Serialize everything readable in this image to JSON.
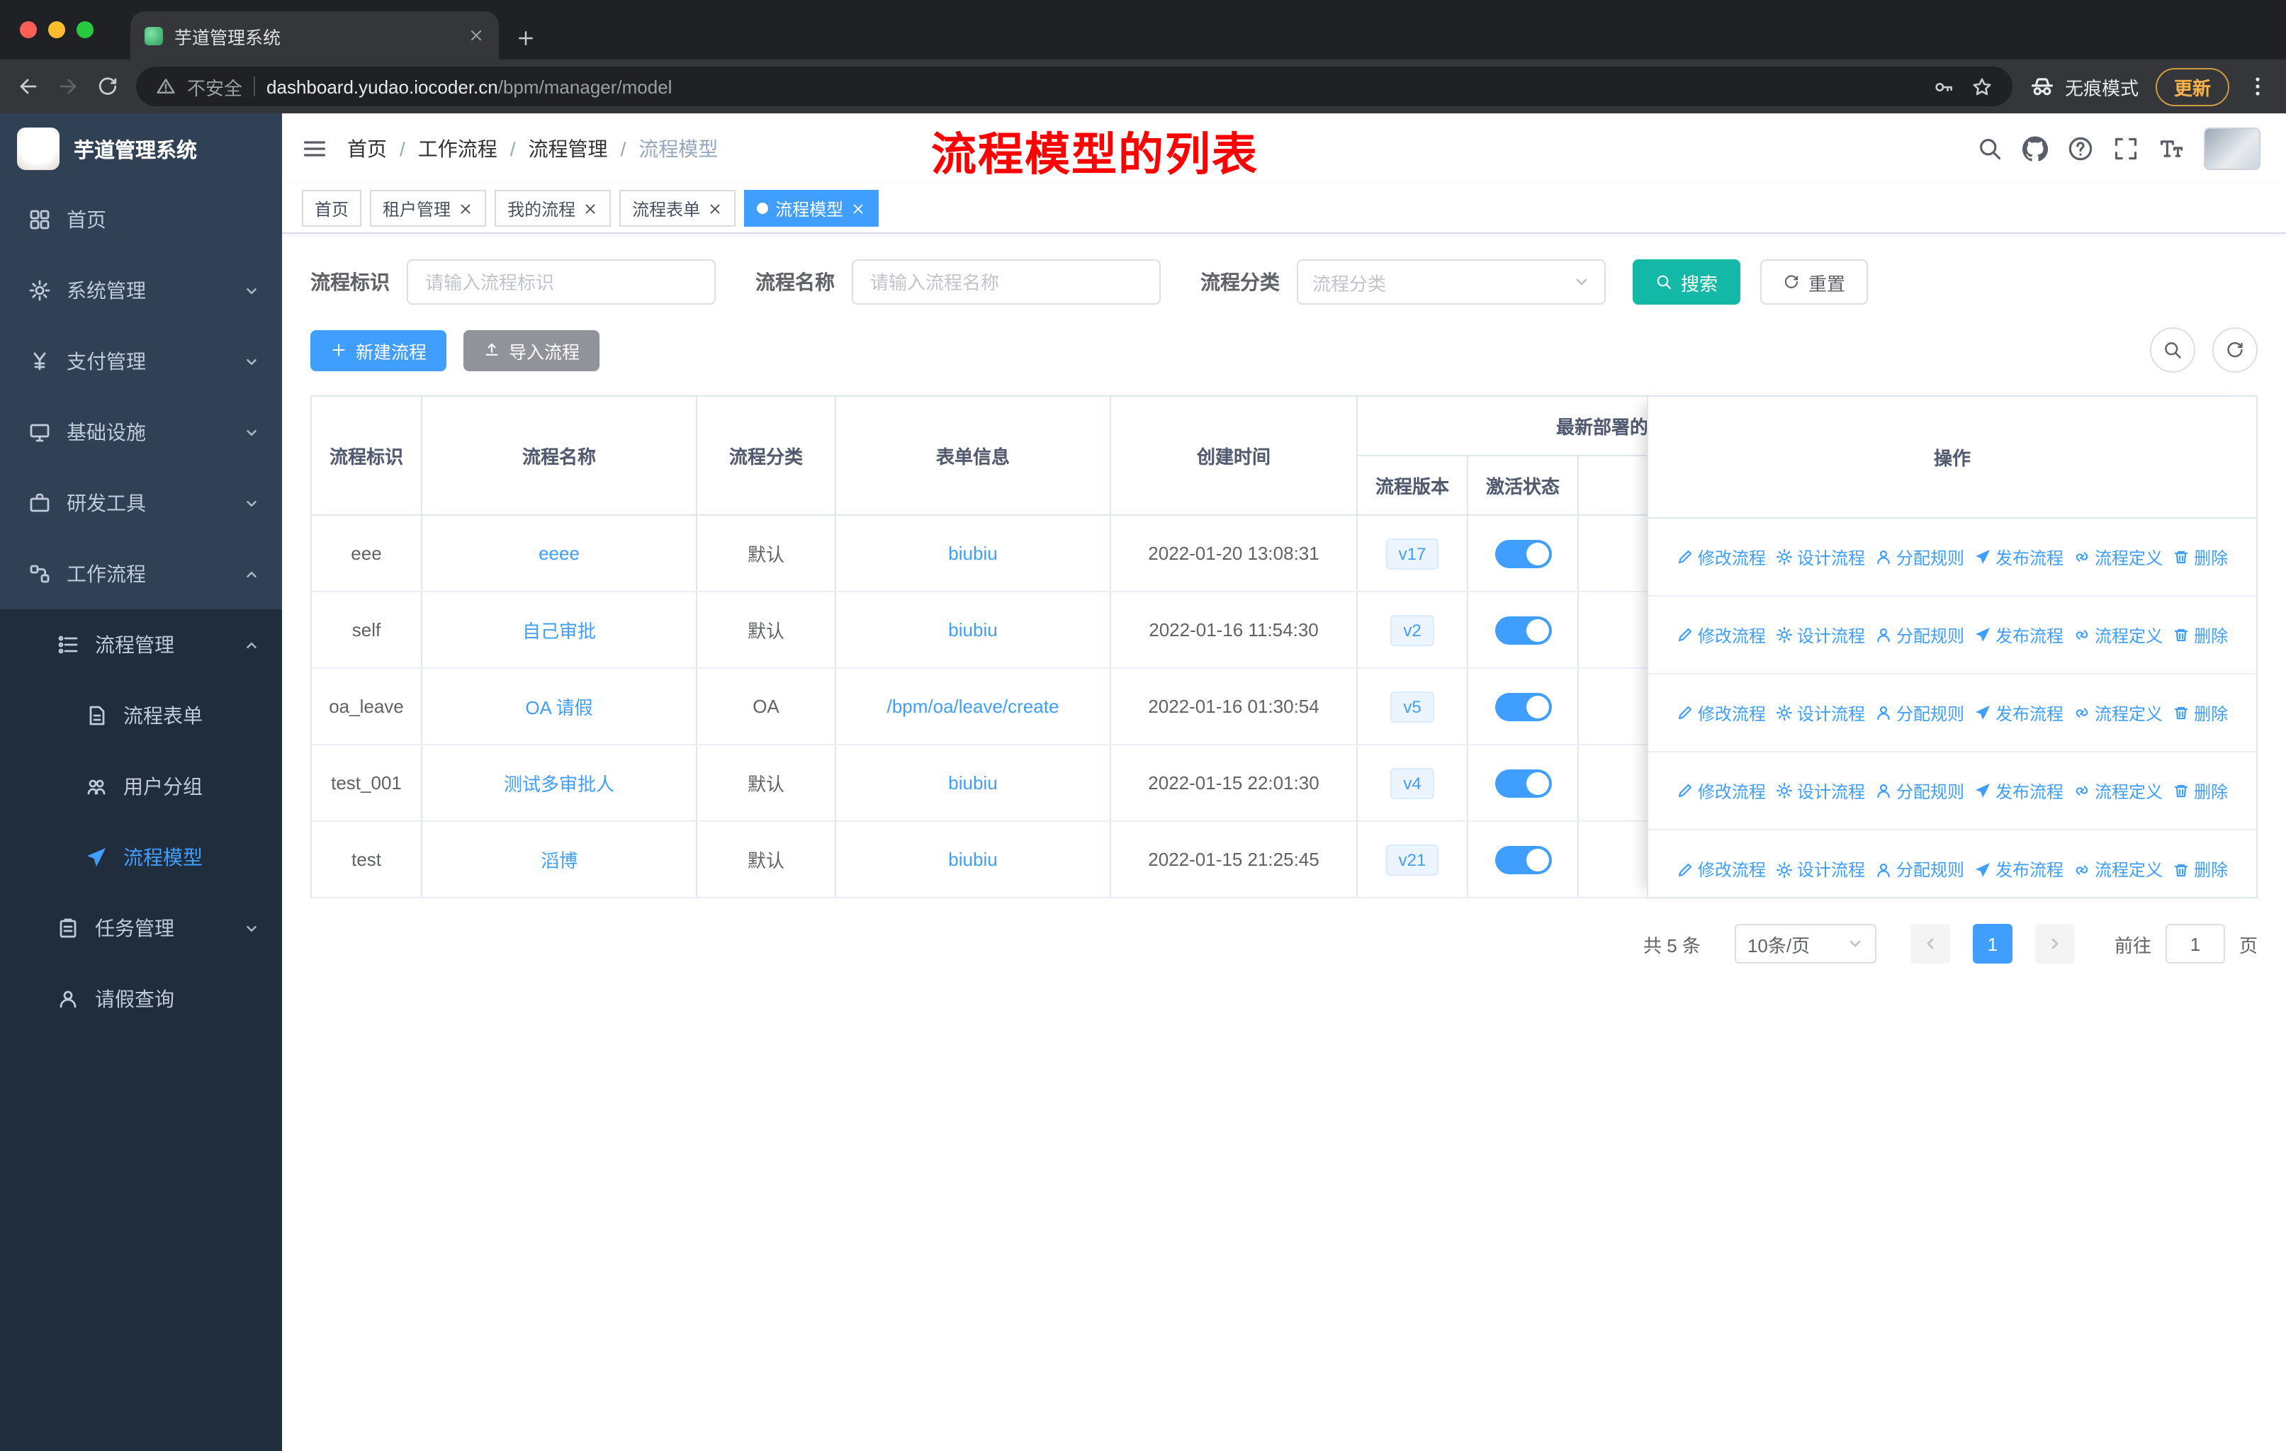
{
  "browser": {
    "tab_title": "芋道管理系统",
    "security_label": "不安全",
    "url_host": "dashboard.yudao.iocoder.cn",
    "url_path": "/bpm/manager/model",
    "incognito_label": "无痕模式",
    "update_label": "更新"
  },
  "sidebar": {
    "logo_title": "芋道管理系统",
    "items": [
      {
        "label": "首页"
      },
      {
        "label": "系统管理"
      },
      {
        "label": "支付管理"
      },
      {
        "label": "基础设施"
      },
      {
        "label": "研发工具"
      },
      {
        "label": "工作流程"
      },
      {
        "label": "流程管理"
      },
      {
        "label": "流程表单"
      },
      {
        "label": "用户分组"
      },
      {
        "label": "流程模型"
      },
      {
        "label": "任务管理"
      },
      {
        "label": "请假查询"
      }
    ]
  },
  "navbar": {
    "breadcrumb": [
      {
        "label": "首页"
      },
      {
        "label": "工作流程"
      },
      {
        "label": "流程管理"
      },
      {
        "label": "流程模型"
      }
    ],
    "breadcrumb_separator": "/",
    "annotation": "流程模型的列表"
  },
  "tags": [
    {
      "label": "首页"
    },
    {
      "label": "租户管理"
    },
    {
      "label": "我的流程"
    },
    {
      "label": "流程表单"
    },
    {
      "label": "流程模型"
    }
  ],
  "filters": {
    "process_id": {
      "label": "流程标识",
      "placeholder": "请输入流程标识"
    },
    "process_name": {
      "label": "流程名称",
      "placeholder": "请输入流程名称"
    },
    "process_category": {
      "label": "流程分类",
      "placeholder": "流程分类"
    },
    "search_label": "搜索",
    "reset_label": "重置"
  },
  "toolbar": {
    "create_label": "新建流程",
    "import_label": "导入流程"
  },
  "table": {
    "headers": {
      "id": "流程标识",
      "name": "流程名称",
      "category": "流程分类",
      "form": "表单信息",
      "created": "创建时间",
      "group": "最新部署的",
      "version": "流程版本",
      "status": "激活状态",
      "ops": "操作"
    },
    "actions": [
      "修改流程",
      "设计流程",
      "分配规则",
      "发布流程",
      "流程定义",
      "删除"
    ],
    "rows": [
      {
        "id": "eee",
        "name": "eeee",
        "category": "默认",
        "form": "biubiu",
        "created": "2022-01-20 13:08:31",
        "version": "v17",
        "active": true
      },
      {
        "id": "self",
        "name": "自己审批",
        "category": "默认",
        "form": "biubiu",
        "created": "2022-01-16 11:54:30",
        "version": "v2",
        "active": true
      },
      {
        "id": "oa_leave",
        "name": "OA 请假",
        "category": "OA",
        "form": "/bpm/oa/leave/create",
        "created": "2022-01-16 01:30:54",
        "version": "v5",
        "active": true
      },
      {
        "id": "test_001",
        "name": "测试多审批人",
        "category": "默认",
        "form": "biubiu",
        "created": "2022-01-15 22:01:30",
        "version": "v4",
        "active": true
      },
      {
        "id": "test",
        "name": "滔博",
        "category": "默认",
        "form": "biubiu",
        "created": "2022-01-15 21:25:45",
        "version": "v21",
        "active": true
      }
    ]
  },
  "pagination": {
    "total": "共 5 条",
    "page_size": "10条/页",
    "current_page": "1",
    "goto_label": "前往",
    "goto_value": "1",
    "page_unit": "页"
  },
  "colors": {
    "primary": "#409eff",
    "search_button": "#14b8a6",
    "info_button": "#909399",
    "annotation_red": "#ff0000",
    "sidebar_bg": "#304156",
    "submenu_bg": "#1f2d3d"
  }
}
